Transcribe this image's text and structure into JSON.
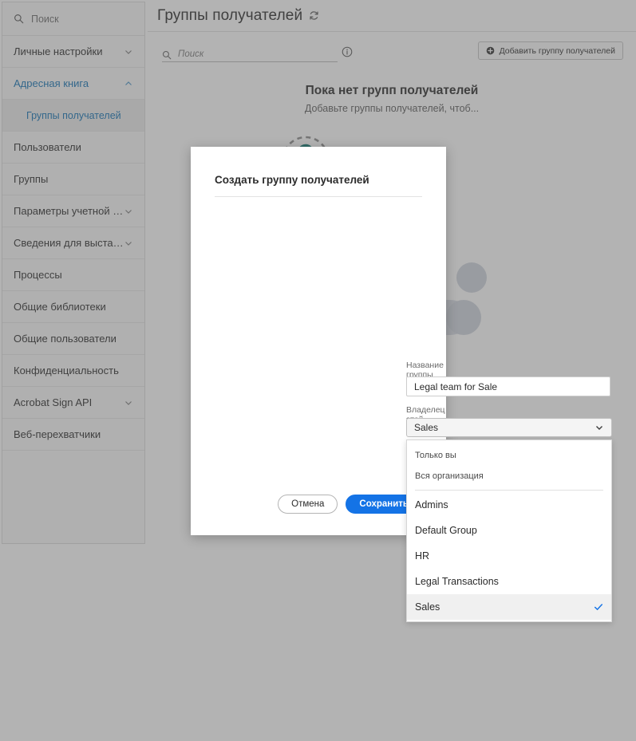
{
  "sidebar": {
    "search": {
      "placeholder": "Поиск",
      "icon": "search-icon"
    },
    "items": [
      {
        "label": "Личные настройки",
        "icon": "chevron-down-icon",
        "expandable": true,
        "active": false
      },
      {
        "label": "Адресная книга",
        "icon": "chevron-up-icon",
        "expandable": true,
        "active": true
      },
      {
        "label": "Пользователи",
        "expandable": false,
        "active": false
      },
      {
        "label": "Группы",
        "expandable": false,
        "active": false
      },
      {
        "label": "Параметры учетной з...",
        "icon": "chevron-down-icon",
        "expandable": true,
        "active": false
      },
      {
        "label": "Сведения для выстав...",
        "icon": "chevron-down-icon",
        "expandable": true,
        "active": false
      },
      {
        "label": "Процессы",
        "expandable": false,
        "active": false
      },
      {
        "label": "Общие библиотеки",
        "expandable": false,
        "active": false
      },
      {
        "label": "Общие пользователи",
        "expandable": false,
        "active": false
      },
      {
        "label": "Конфиденциальность",
        "expandable": false,
        "active": false
      },
      {
        "label": "Acrobat Sign API",
        "icon": "chevron-down-icon",
        "expandable": true,
        "active": false
      },
      {
        "label": "Веб-перехватчики",
        "expandable": false,
        "active": false
      }
    ],
    "submenu": {
      "label": "Группы получателей",
      "selected": true
    }
  },
  "header": {
    "title": "Группы получателей",
    "refresh_icon": "refresh-icon"
  },
  "toolbar": {
    "search_placeholder": "Поиск",
    "search_icon": "search-icon",
    "info_icon": "info-circle-icon",
    "add_button_label": "Добавить группу получателей",
    "add_button_icon": "plus-circle-icon"
  },
  "empty_state": {
    "title": "Пока нет групп получателей",
    "subtitle": "Добавьте группы получателей, чтоб..."
  },
  "modal": {
    "title": "Создать группу получателей",
    "name_field": {
      "label": "Название группы получателей",
      "required_mark": "✲",
      "value": "Legal team for Sale"
    },
    "owner_field": {
      "label": "Владелец этой группы",
      "required_mark": "✲",
      "selected": "Sales",
      "chevron_icon": "chevron-down-icon",
      "options": [
        {
          "label": "Только вы",
          "style": "small",
          "selected": false
        },
        {
          "label": "Вся организация",
          "style": "small",
          "selected": false
        },
        {
          "label": "Admins",
          "style": "big",
          "selected": false
        },
        {
          "label": "Default Group",
          "style": "big",
          "selected": false
        },
        {
          "label": "HR",
          "style": "big",
          "selected": false
        },
        {
          "label": "Legal Transactions",
          "style": "big",
          "selected": false
        },
        {
          "label": "Sales",
          "style": "big",
          "selected": true
        }
      ]
    },
    "cancel_label": "Отмена",
    "save_label": "Сохранить"
  },
  "colors": {
    "accent_blue": "#1473e6",
    "link_blue": "#1473b5",
    "teal": "#0f7a73",
    "overlay": "rgba(90,90,90,0.46)"
  }
}
